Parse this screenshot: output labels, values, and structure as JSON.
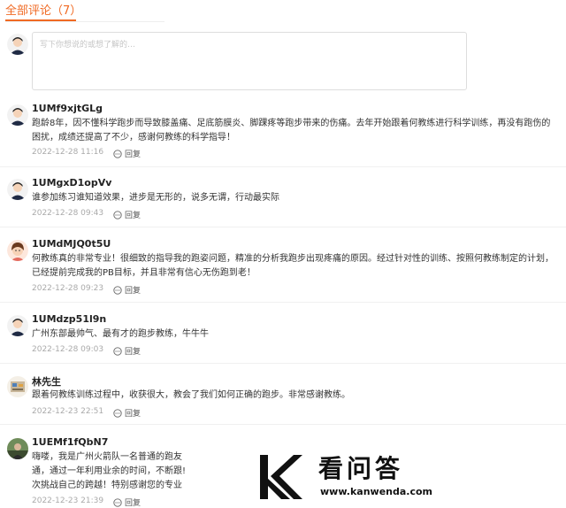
{
  "tabs": {
    "all_comments": "全部评论（7）"
  },
  "composer": {
    "placeholder": "写下你想说的或想了解的…"
  },
  "reply_label": "回复",
  "comments": [
    {
      "name": "1UMf9xjtGLg",
      "avatar": "cartoon-man-avatar",
      "text": "跑龄8年，因不懂科学跑步而导致膝盖痛、足底筋膜炎、脚踝疼等跑步带来的伤痛。去年开始跟着何教练进行科学训练，再没有跑伤的困扰，成绩还提高了不少，感谢何教练的科学指导！",
      "time": "2022-12-28 11:16"
    },
    {
      "name": "1UMgxD1opVv",
      "avatar": "cartoon-man-avatar",
      "text": "谁参加练习谁知道效果，进步是无形的，说多无谓，行动最实际",
      "time": "2022-12-28 09:43"
    },
    {
      "name": "1UMdMJQ0t5U",
      "avatar": "cartoon-girl-avatar",
      "text": "何教练真的非常专业！很细致的指导我的跑姿问题，精准的分析我跑步出现疼痛的原因。经过针对性的训练、按照何教练制定的计划，已经提前完成我的PB目标，并且非常有信心无伤跑到老！",
      "time": "2022-12-28 09:23"
    },
    {
      "name": "1UMdzp51l9n",
      "avatar": "cartoon-man-avatar",
      "text": "广州东部最帅气、最有才的跑步教练，牛牛牛",
      "time": "2022-12-28 09:03"
    },
    {
      "name": "林先生",
      "avatar": "photo-avatar",
      "text": "跟着何教练训练过程中，收获很大，教会了我们如何正确的跑步。非常感谢教练。",
      "time": "2022-12-23 22:51"
    },
    {
      "name": "1UEMf1fQbN7",
      "avatar": "photo-avatar",
      "text": "嗨喽，我是广州火箭队一名普通的跑友\n通，通过一年利用业余的时间，不断跟!\n次挑战自己的跨越！特别感谢您的专业",
      "time": "2022-12-23 21:39"
    }
  ],
  "watermark": {
    "title": "看问答",
    "url": "www.kanwenda.com"
  },
  "colors": {
    "accent": "#f06a23",
    "meta_text": "#aaaaaa",
    "border": "#dddddd"
  }
}
